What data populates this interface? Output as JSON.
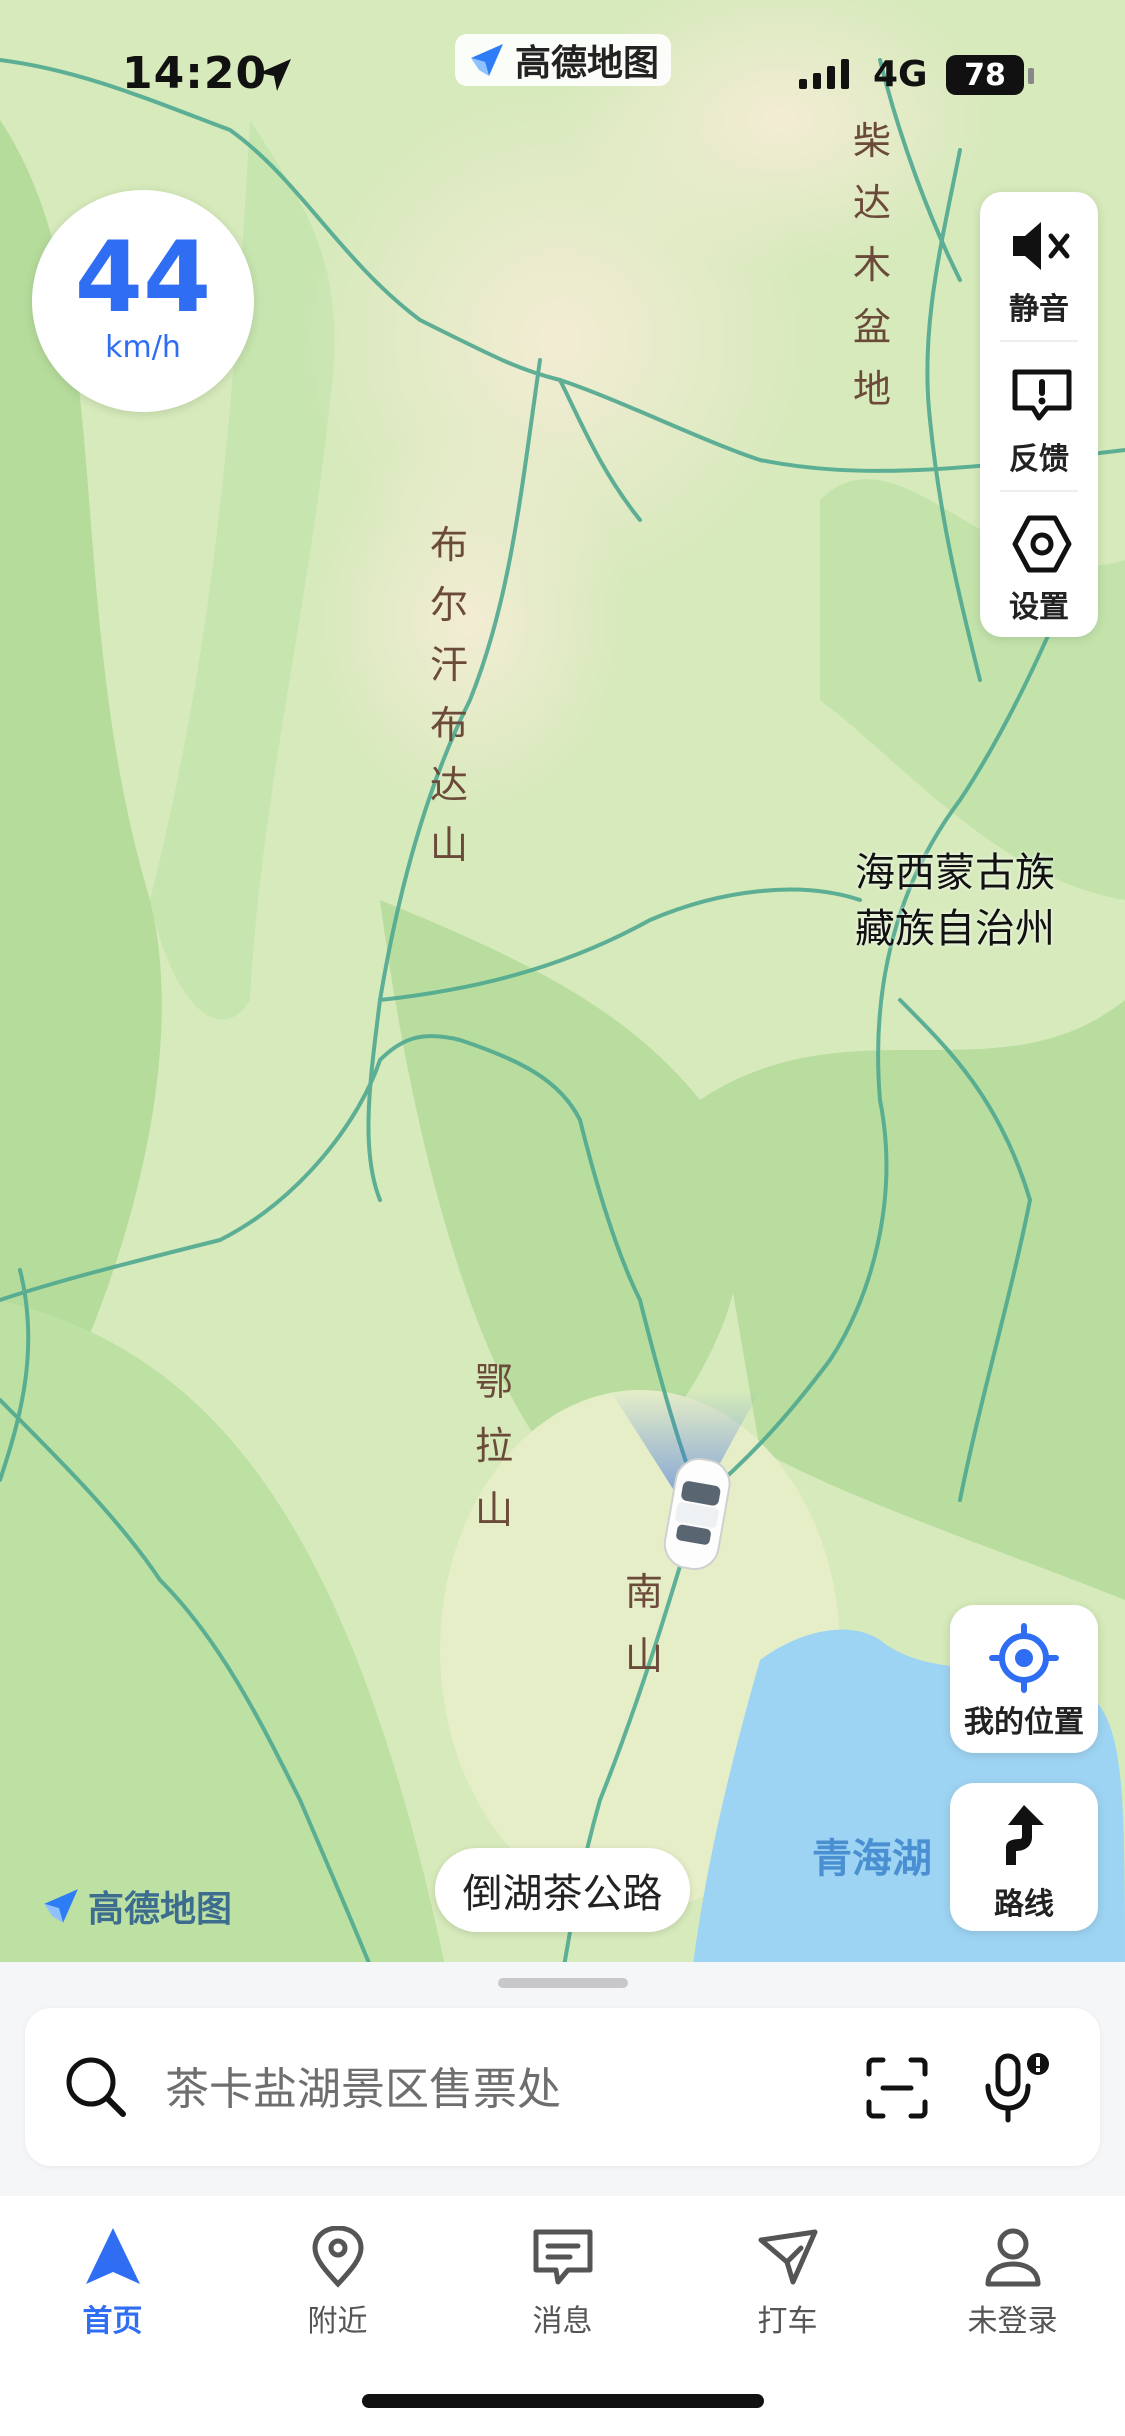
{
  "status_bar": {
    "time": "14:20",
    "network": "4G",
    "battery": "78",
    "brand": "高德地图"
  },
  "speed": {
    "value": "44",
    "unit": "km/h"
  },
  "tools": [
    {
      "label": "静音",
      "icon": "mute-icon"
    },
    {
      "label": "反馈",
      "icon": "feedback-icon"
    },
    {
      "label": "设置",
      "icon": "settings-icon"
    }
  ],
  "map": {
    "labels": {
      "chaidamu": "柴达木盆地",
      "buerhan": "布尔汗布达山",
      "ela": "鄂拉山",
      "nan": "南山",
      "region": "海西蒙古族\n藏族自治州",
      "lake": "青海湖"
    },
    "road": "倒湖茶公路",
    "watermark": "高德地图",
    "colors": {
      "land": "#dcebc2",
      "green": "#b9dfa2",
      "road": "#4fa890",
      "water": "#9ed4f3",
      "accent": "#2f6ef3"
    }
  },
  "buttons": {
    "my_location": "我的位置",
    "route": "路线"
  },
  "search": {
    "placeholder": "茶卡盐湖景区售票处"
  },
  "tabs": [
    {
      "label": "首页",
      "icon": "home-nav-icon",
      "active": true
    },
    {
      "label": "附近",
      "icon": "location-pin-icon"
    },
    {
      "label": "消息",
      "icon": "message-icon"
    },
    {
      "label": "打车",
      "icon": "taxi-icon"
    },
    {
      "label": "未登录",
      "icon": "user-icon"
    }
  ]
}
